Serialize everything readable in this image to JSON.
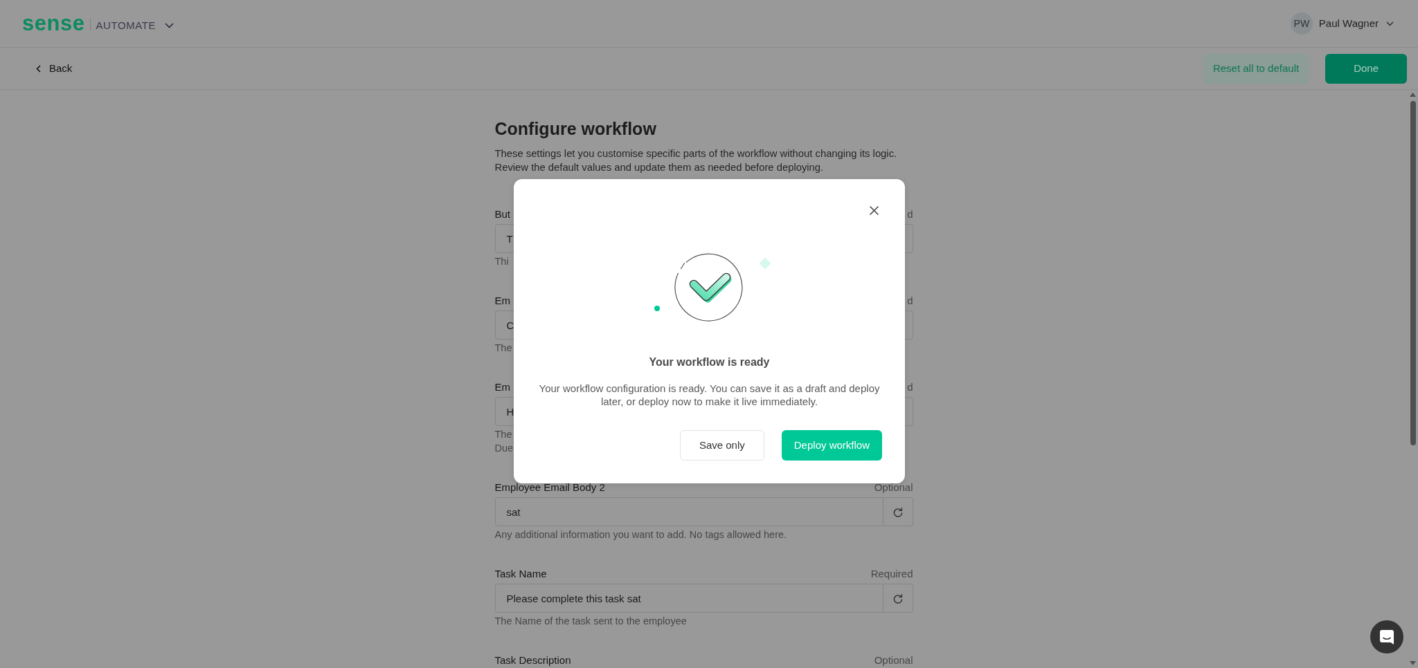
{
  "header": {
    "logo": "sense",
    "product": "AUTOMATE",
    "user": {
      "initials": "PW",
      "name": "Paul Wagner"
    }
  },
  "toolbar": {
    "back": "Back",
    "buttons": [
      {
        "label": "Reset all to default",
        "kind": "secondary"
      },
      {
        "label": "Done",
        "kind": "primary"
      }
    ]
  },
  "form": {
    "title": "Configure workflow",
    "description": "These settings let you customise specific parts of the workflow without changing its logic. Review the default values and update them as needed before deploying.",
    "fields": [
      {
        "label": "But",
        "badge": "d",
        "value": "T",
        "hint": "Thi",
        "reset": false
      },
      {
        "label": "Em",
        "badge": "d",
        "value": "C",
        "hint": "The",
        "reset": false
      },
      {
        "label": "Em",
        "badge": "d",
        "value": "H",
        "hint": "The\nDue",
        "reset": false
      },
      {
        "label": "Employee Email Body 2",
        "badge": "Optional",
        "value": "sat",
        "hint": "Any additional information you want to add. No tags allowed here.",
        "reset": true
      },
      {
        "label": "Task Name",
        "badge": "Required",
        "value": "Please complete this task sat",
        "hint": "The Name of the task sent to the employee",
        "reset": true
      },
      {
        "label": "Task Description",
        "badge": "Optional"
      }
    ]
  },
  "dialog": {
    "title": "Your workflow is ready",
    "message": "Your workflow configuration is ready. You can save it as a draft and deploy later, or deploy now to make it live immediately.",
    "buttons": [
      {
        "label": "Save only",
        "kind": "secondary"
      },
      {
        "label": "Deploy workflow",
        "kind": "primary"
      }
    ]
  }
}
